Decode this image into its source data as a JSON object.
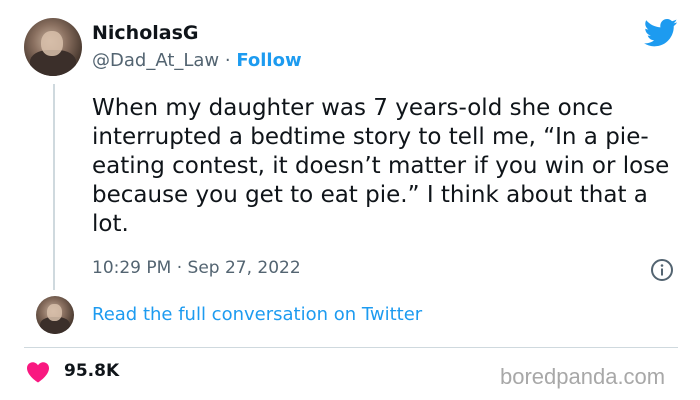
{
  "author": {
    "name": "NicholasG",
    "handle": "@Dad_At_Law",
    "separator": " · ",
    "follow_label": "Follow"
  },
  "tweet": {
    "text": "When my daughter was 7 years-old she once interrupted a bedtime story to tell me, “In a pie-eating contest, it doesn’t matter if you win or lose because you get to eat pie.” I think about that a lot.",
    "timestamp": "10:29 PM · Sep 27, 2022"
  },
  "conversation_link": "Read the full conversation on Twitter",
  "likes": {
    "count": "95.8K"
  },
  "watermark": "boredpanda.com",
  "icons": {
    "brand": "twitter-bird-icon",
    "info": "info-icon",
    "like": "heart-icon"
  },
  "colors": {
    "accent": "#1d9bf0",
    "heart": "#f91880",
    "secondary_text": "#536471"
  }
}
